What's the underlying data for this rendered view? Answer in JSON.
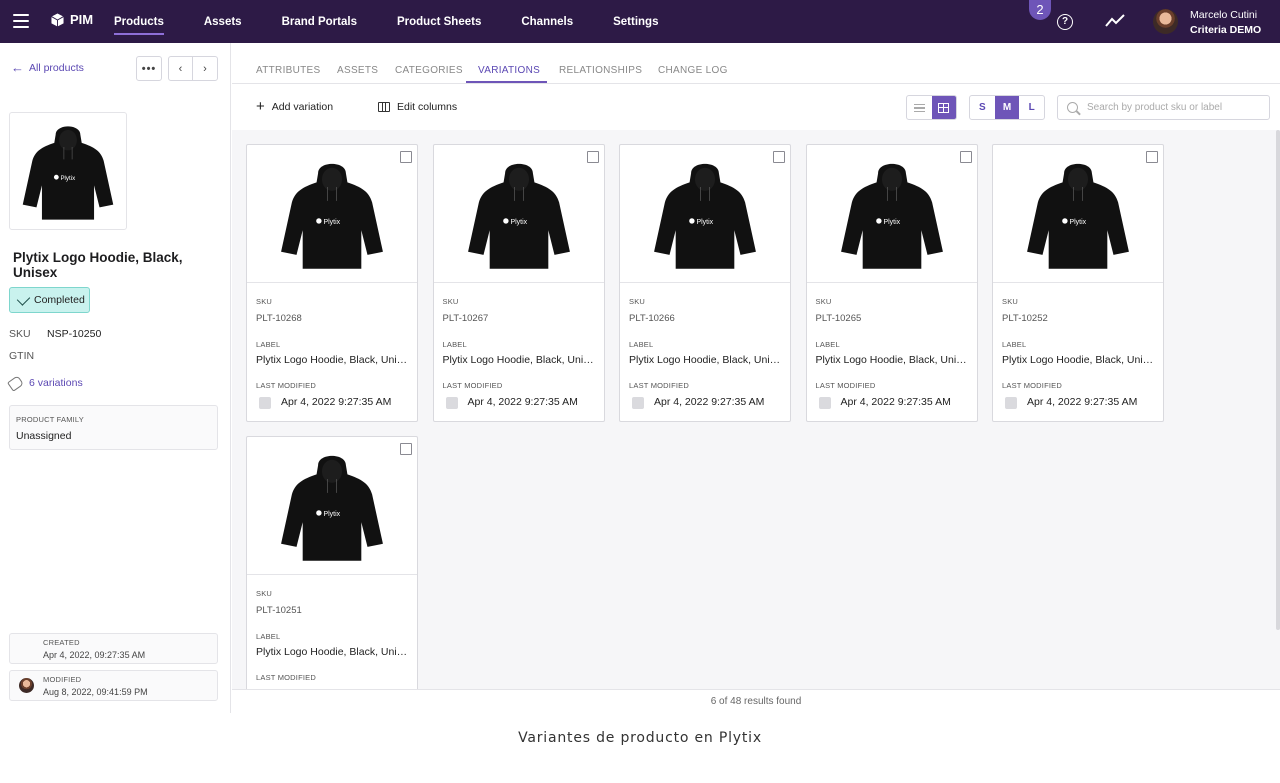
{
  "topnav": {
    "brand": "PIM",
    "items": [
      "Products",
      "Assets",
      "Brand Portals",
      "Product Sheets",
      "Channels",
      "Settings"
    ],
    "active_index": 0,
    "notifications": "2",
    "user_name": "Marcelo Cutini",
    "user_org": "Criteria DEMO",
    "icons": [
      "menu-icon",
      "cube-logo-icon",
      "help-icon",
      "activity-icon",
      "avatar"
    ]
  },
  "sidebar": {
    "back_label": "All products",
    "more_label": "•••",
    "prev_label": "‹",
    "next_label": "›",
    "title": "Plytix Logo Hoodie, Black, Unisex",
    "status": "Completed",
    "sku_label": "SKU",
    "sku_value": "NSP-10250",
    "gtin_label": "GTIN",
    "variations_link": "6 variations",
    "family_label": "PRODUCT FAMILY",
    "family_value": "Unassigned",
    "created_label": "CREATED",
    "created_value": "Apr 4, 2022, 09:27:35 AM",
    "modified_label": "MODIFIED",
    "modified_value": "Aug 8, 2022, 09:41:59 PM"
  },
  "tabs": [
    "ATTRIBUTES",
    "ASSETS",
    "CATEGORIES",
    "VARIATIONS",
    "RELATIONSHIPS",
    "CHANGE LOG"
  ],
  "active_tab": "VARIATIONS",
  "toolbar": {
    "add_variation": "Add variation",
    "edit_columns": "Edit columns",
    "sizes": [
      "S",
      "M",
      "L"
    ],
    "active_size": "M",
    "view_mode": "grid",
    "search_placeholder": "Search by product sku or label"
  },
  "card_labels": {
    "sku": "SKU",
    "label": "LABEL",
    "modified": "LAST MODIFIED"
  },
  "variations": [
    {
      "sku": "PLT-10268",
      "label": "Plytix Logo Hoodie, Black, Unisex",
      "modified": "Apr 4, 2022 9:27:35 AM"
    },
    {
      "sku": "PLT-10267",
      "label": "Plytix Logo Hoodie, Black, Unisex",
      "modified": "Apr 4, 2022 9:27:35 AM"
    },
    {
      "sku": "PLT-10266",
      "label": "Plytix Logo Hoodie, Black, Unisex",
      "modified": "Apr 4, 2022 9:27:35 AM"
    },
    {
      "sku": "PLT-10265",
      "label": "Plytix Logo Hoodie, Black, Unisex",
      "modified": "Apr 4, 2022 9:27:35 AM"
    },
    {
      "sku": "PLT-10252",
      "label": "Plytix Logo Hoodie, Black, Unisex",
      "modified": "Apr 4, 2022 9:27:35 AM"
    },
    {
      "sku": "PLT-10251",
      "label": "Plytix Logo Hoodie, Black, Unisex",
      "modified": ""
    }
  ],
  "hoodie_print": "Plytix",
  "results_text": "6 of 48 results found",
  "caption": "Variantes de producto en Plytix",
  "colors": {
    "nav_bg": "#2d1a46",
    "accent": "#6e55b8",
    "status_bg": "#c9f2ee"
  }
}
